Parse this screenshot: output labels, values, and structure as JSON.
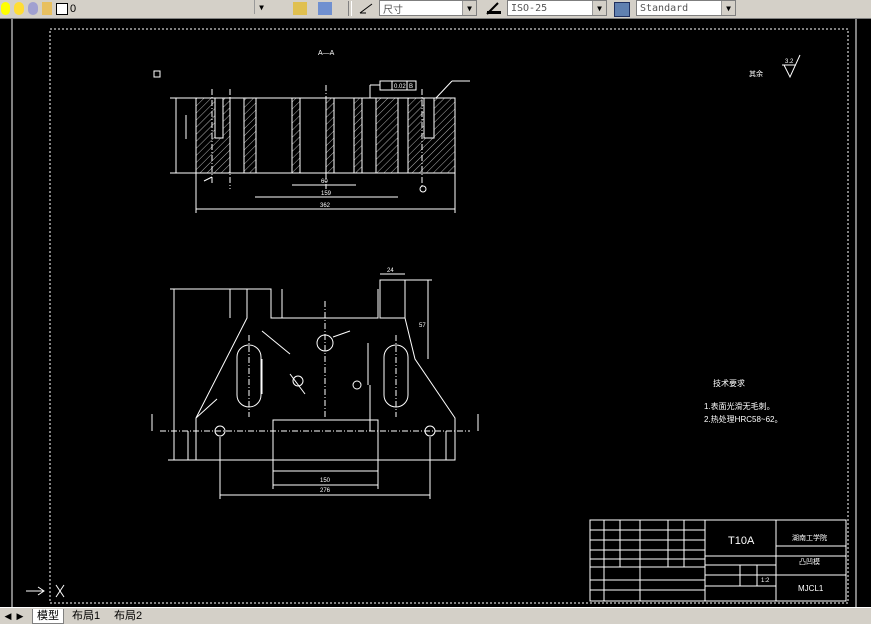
{
  "toolbar": {
    "layer_value": "0",
    "dimstyle_value": "尺寸",
    "dimstyle_name": "ISO-25",
    "textstyle_name": "Standard"
  },
  "drawing": {
    "section_label": "A—A",
    "tolerance": "0.02",
    "tolerance_datum": "B",
    "roughness_value": "3.2",
    "roughness_note": "其余",
    "dims_section": [
      "60",
      "159",
      "362",
      "24",
      "6"
    ],
    "dims_plan": [
      "24",
      "57",
      "150",
      "276",
      "62",
      "52"
    ],
    "tech_title": "技术要求",
    "tech_items": [
      "1.表面光滑无毛刺。",
      "2.热处理HRC58~62。"
    ],
    "material": "T10A",
    "school": "湖南工学院",
    "part_name": "凸凹模",
    "drawing_code": "MJCL1",
    "scale": "1:2"
  },
  "tabs": [
    {
      "label": "模型"
    },
    {
      "label": "布局1"
    },
    {
      "label": "布局2"
    }
  ],
  "colors": {
    "line": "#ffffff",
    "background": "#000000",
    "toolbar": "#d4d0c8"
  }
}
